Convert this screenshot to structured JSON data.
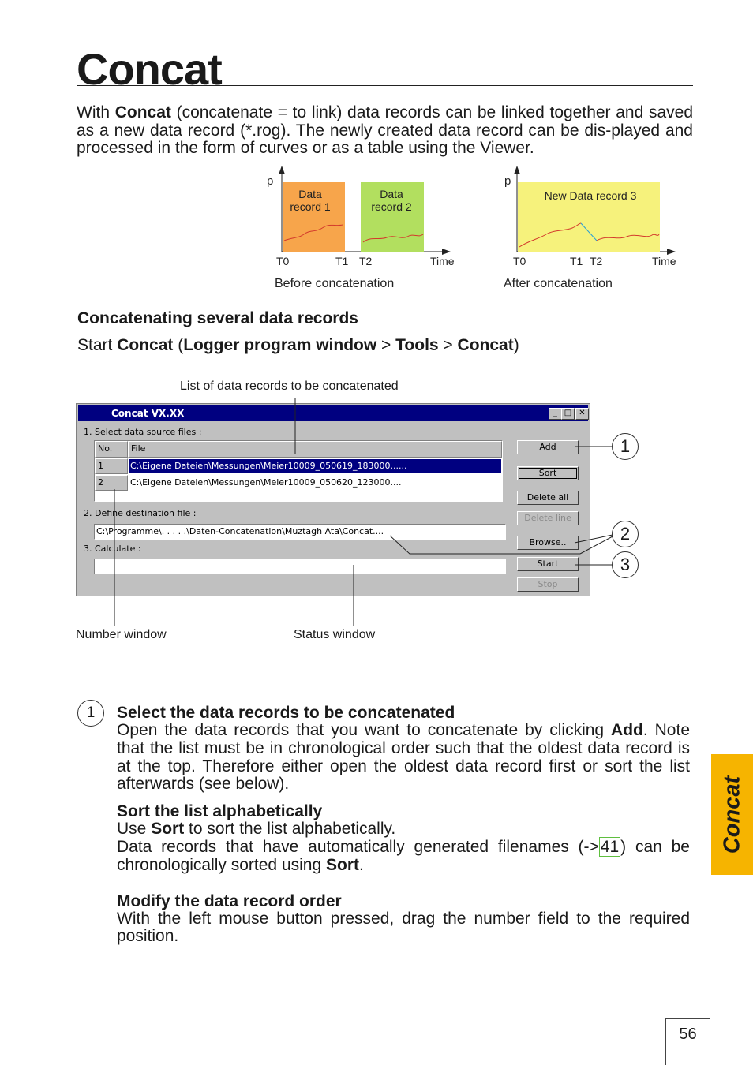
{
  "title": "Concat",
  "intro": {
    "before": "With ",
    "bold": "Concat",
    "after": " (concatenate = to link) data records can be linked together and saved as a new data record (*.rog). The newly created data record can be dis-played and processed in the form of curves or as a table using the Viewer."
  },
  "diagram": {
    "before": {
      "axis_p": "p",
      "box1": [
        "Data",
        "record 1"
      ],
      "box2": [
        "Data",
        "record 2"
      ],
      "ticks": [
        "T0",
        "T1",
        "T2",
        "Time"
      ],
      "caption": "Before concatenation"
    },
    "after": {
      "axis_p": "p",
      "box": "New Data record 3",
      "ticks": [
        "T0",
        "T1",
        "T2",
        "Time"
      ],
      "caption": "After concatenation"
    },
    "colors": {
      "record1": "#f7a54b",
      "record2": "#b2df5f",
      "record3": "#f6f27c",
      "curve": "#d33a2c"
    }
  },
  "section": {
    "heading": "Concatenating several data records",
    "start": {
      "pre": "Start ",
      "concat": "Concat",
      "open": " (",
      "win": "Logger program window",
      "gt1": " > ",
      "tools": "Tools",
      "gt2": " > ",
      "concat2": "Concat",
      "close": ")"
    }
  },
  "screenshot": {
    "label_top": "List of data records to be concatenated",
    "label_number": "Number window",
    "label_status": "Status window",
    "window_title": "Concat  VX.XX",
    "step1": "1. Select data source files :",
    "step2": "2. Define destination file :",
    "step3": "3. Calculate :",
    "table_headers": [
      "No.",
      "File"
    ],
    "rows": [
      {
        "no": "1",
        "file": "C:\\Eigene Dateien\\Messungen\\Meier10009_050619_183000......",
        "selected": true
      },
      {
        "no": "2",
        "file": "C:\\Eigene Dateien\\Messungen\\Meier10009_050620_123000....",
        "selected": false
      }
    ],
    "destination": "C:\\Programme\\. . . . .\\Daten-Concatenation\\Muztagh Ata\\Concat....",
    "buttons": {
      "add": "Add",
      "sort": "Sort",
      "delete_all": "Delete all",
      "delete_line": "Delete line",
      "browse": "Browse..",
      "start": "Start",
      "stop": "Stop"
    },
    "callouts": [
      "1",
      "2",
      "3"
    ]
  },
  "step1": {
    "num": "1",
    "heading": "Select the data records to be concatenated",
    "p1_a": "Open the data records that you want to concatenate by clicking ",
    "p1_bold": "Add",
    "p1_b": ". Note that the list must be in chronological order such that the oldest data record is at the top. Therefore either open the oldest data record first or sort the list afterwards (see below).",
    "sort_heading": "Sort the list alphabetically",
    "sort_a": "Use ",
    "sort_bold": "Sort",
    "sort_b": " to sort the list alphabetically.",
    "sort2_a": "Data records that have automatically generated filenames (->",
    "sort2_link": "41",
    "sort2_b": ") can be chronologically sorted using ",
    "sort2_bold": "Sort",
    "sort2_c": ".",
    "order_heading": "Modify the data record order",
    "order_text": "With the left mouse button pressed, drag the number field to the required position."
  },
  "side_tab": "Concat",
  "page_number": "56"
}
